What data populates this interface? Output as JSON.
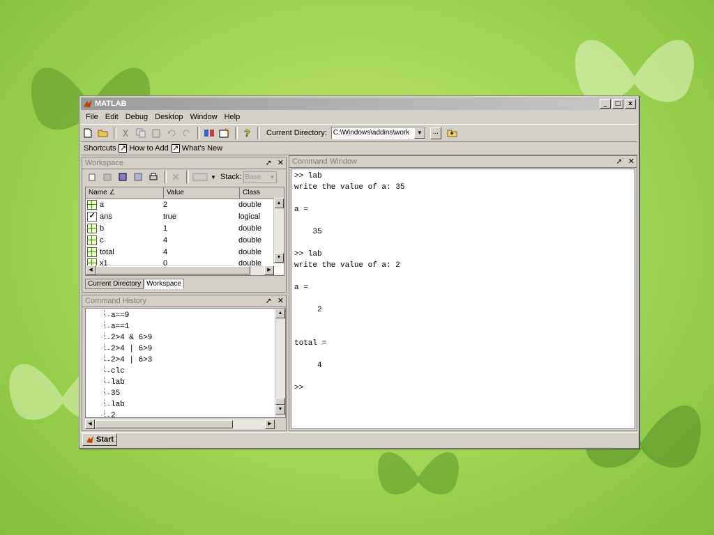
{
  "window": {
    "title": "MATLAB",
    "controls": [
      "_",
      "□",
      "x"
    ]
  },
  "menu": [
    "File",
    "Edit",
    "Debug",
    "Desktop",
    "Window",
    "Help"
  ],
  "toolbar": {
    "current_directory_label": "Current Directory:",
    "current_directory_value": "C:\\Windows\\addins\\work",
    "browse_label": "..."
  },
  "shortcuts": {
    "label": "Shortcuts",
    "items": [
      "How to Add",
      "What's New"
    ]
  },
  "workspace": {
    "title": "Workspace",
    "stack_label": "Stack:",
    "stack_value": "Base",
    "columns": [
      "Name",
      "Value",
      "Class"
    ],
    "rows": [
      {
        "name": "a",
        "value": "2",
        "class": "double",
        "icon": "grid-icon"
      },
      {
        "name": "ans",
        "value": "true",
        "class": "logical",
        "icon": "check-icon"
      },
      {
        "name": "b",
        "value": "1",
        "class": "double",
        "icon": "grid-icon"
      },
      {
        "name": "c",
        "value": "4",
        "class": "double",
        "icon": "grid-icon"
      },
      {
        "name": "total",
        "value": "4",
        "class": "double",
        "icon": "grid-icon"
      },
      {
        "name": "x1",
        "value": "0",
        "class": "double",
        "icon": "grid-icon"
      }
    ],
    "tabs": [
      "Current Directory",
      "Workspace"
    ]
  },
  "history": {
    "title": "Command History",
    "items": [
      "a==9",
      "a==1",
      "2>4 & 6>9",
      "2>4 | 6>9",
      "2>4 | 6>3",
      "clc",
      "lab",
      "35",
      "lab",
      "2"
    ]
  },
  "command_window": {
    "title": "Command Window",
    "lines": [
      ">> lab",
      "write the value of a: 35",
      "",
      "a =",
      "",
      "    35",
      "",
      ">> lab",
      "write the value of a: 2",
      "",
      "a =",
      "",
      "     2",
      "",
      "",
      "total =",
      "",
      "     4",
      "",
      ">>"
    ]
  },
  "status": {
    "start_label": "Start"
  }
}
